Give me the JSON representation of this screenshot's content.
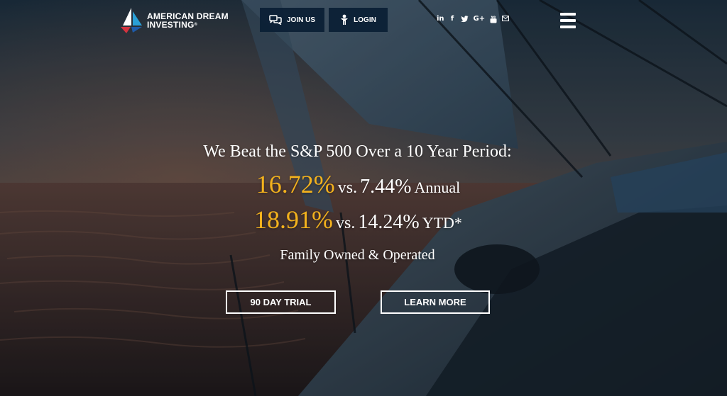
{
  "brand": {
    "name_line1": "AMERICAN DREAM",
    "name_line2": "INVESTING",
    "registered_mark": "®",
    "logo_colors": [
      "#1e5aa8",
      "#d2333f",
      "#2a9fd6",
      "#ffffff"
    ]
  },
  "header": {
    "join_label": "JOIN US",
    "join_icon": "chat-icon",
    "login_label": "LOGIN",
    "login_icon": "person-icon",
    "button_bg": "#0a1e34",
    "social": [
      {
        "name": "linkedin-icon",
        "glyph": "in"
      },
      {
        "name": "facebook-icon",
        "glyph": "f"
      },
      {
        "name": "twitter-icon",
        "glyph": ""
      },
      {
        "name": "google-plus-icon",
        "glyph": "G+"
      },
      {
        "name": "youtube-icon",
        "glyph": ""
      },
      {
        "name": "email-icon",
        "glyph": ""
      }
    ],
    "menu_icon": "hamburger-menu-icon"
  },
  "hero": {
    "headline": "We Beat the S&P 500 Over a 10 Year Period:",
    "annual": {
      "value": "16.72%",
      "vs": "vs.",
      "benchmark": "7.44%",
      "unit": "Annual"
    },
    "ytd": {
      "value": "18.91%",
      "vs": "vs.",
      "benchmark": "14.24%",
      "unit": "YTD*"
    },
    "tagline": "Family Owned & Operated",
    "highlight_color": "#f3b21d",
    "cta_trial": "90 DAY TRIAL",
    "cta_learn": "LEARN MORE"
  }
}
